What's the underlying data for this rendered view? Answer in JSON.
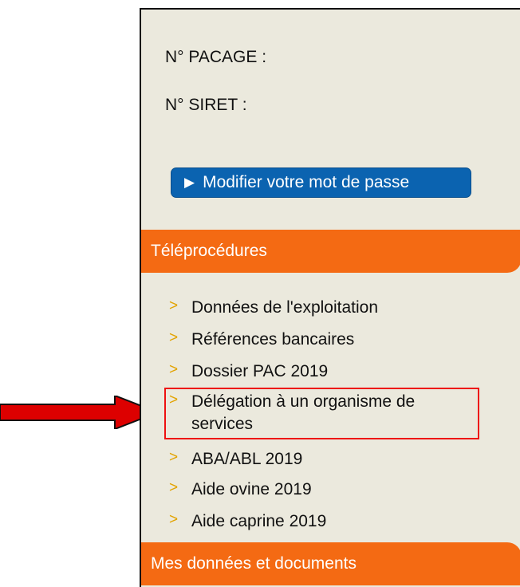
{
  "info": {
    "pacage_label": "N° PACAGE :",
    "siret_label": "N° SIRET :"
  },
  "password_button": {
    "label": "Modifier votre mot de passe"
  },
  "sections": {
    "teleprocedures": "Téléprocédures",
    "mes_donnees": "Mes données et documents"
  },
  "menu": [
    "Données de l'exploitation",
    "Références bancaires",
    "Dossier PAC 2019",
    "Délégation à un organisme de services",
    "ABA/ABL 2019",
    "Aide ovine 2019",
    "Aide caprine 2019"
  ],
  "colors": {
    "panel_bg": "#ebe9dd",
    "orange": "#f46a13",
    "button_blue": "#0b63b0",
    "highlight_red": "#ee1111",
    "arrow_red": "#dd0000"
  }
}
